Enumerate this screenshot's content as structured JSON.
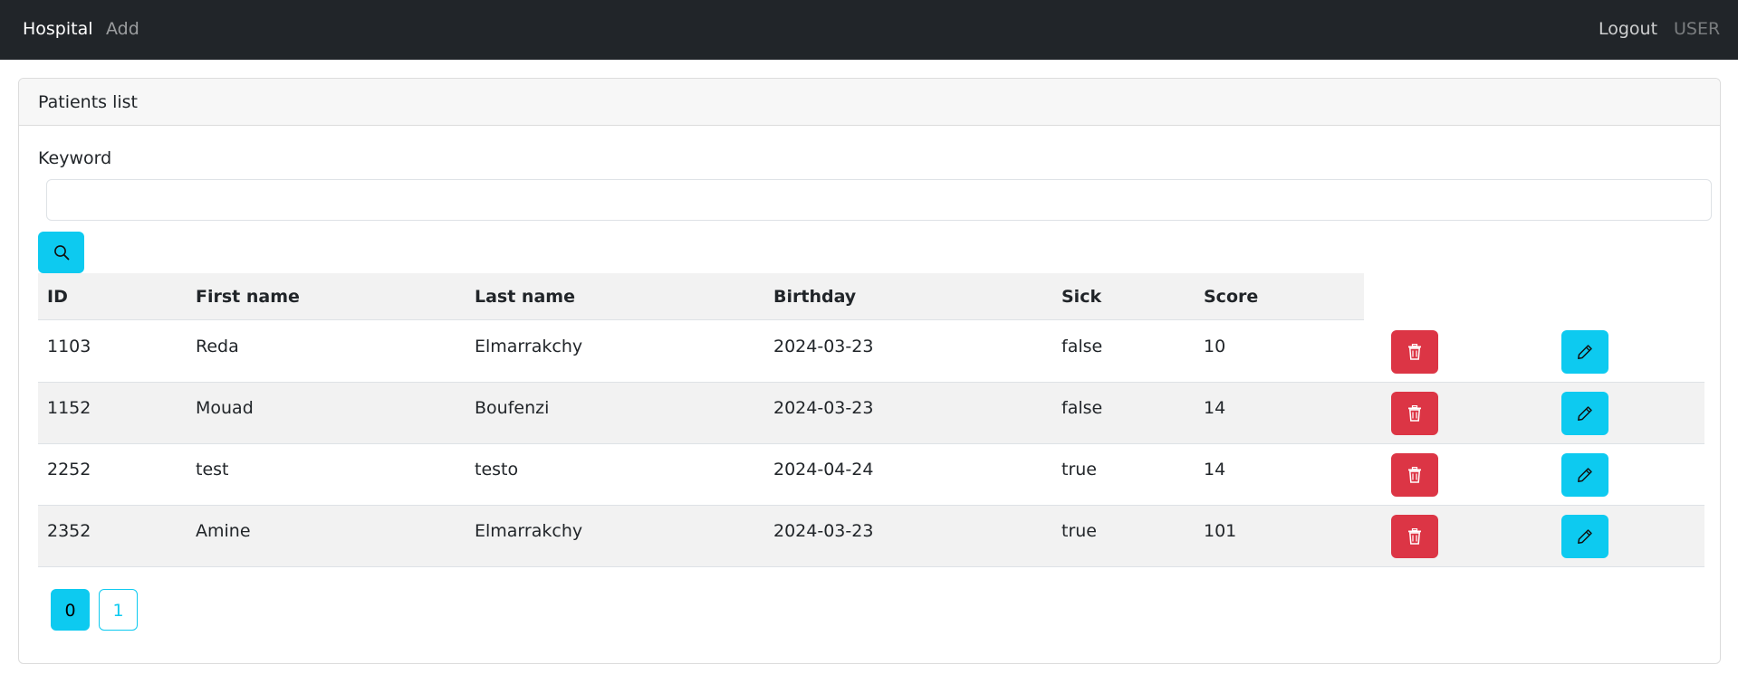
{
  "navbar": {
    "brand": "Hospital",
    "add_label": "Add",
    "logout_label": "Logout",
    "user_label": "USER"
  },
  "card": {
    "title": "Patients list"
  },
  "search": {
    "label": "Keyword",
    "value": "",
    "icon": "search-icon"
  },
  "table": {
    "headers": {
      "id": "ID",
      "first_name": "First name",
      "last_name": "Last name",
      "birthday": "Birthday",
      "sick": "Sick",
      "score": "Score"
    },
    "rows": [
      {
        "id": "1103",
        "first_name": "Reda",
        "last_name": "Elmarrakchy",
        "birthday": "2024-03-23",
        "sick": "false",
        "score": "10"
      },
      {
        "id": "1152",
        "first_name": "Mouad",
        "last_name": "Boufenzi",
        "birthday": "2024-03-23",
        "sick": "false",
        "score": "14"
      },
      {
        "id": "2252",
        "first_name": "test",
        "last_name": "testo",
        "birthday": "2024-04-24",
        "sick": "true",
        "score": "14"
      },
      {
        "id": "2352",
        "first_name": "Amine",
        "last_name": "Elmarrakchy",
        "birthday": "2024-03-23",
        "sick": "true",
        "score": "101"
      }
    ],
    "delete_icon": "trash-icon",
    "edit_icon": "pencil-icon"
  },
  "pagination": {
    "pages": [
      "0",
      "1"
    ],
    "current": "0"
  },
  "colors": {
    "navbar_bg": "#212529",
    "info": "#0dcaf0",
    "danger": "#dc3545",
    "stripe": "#f2f2f2"
  }
}
